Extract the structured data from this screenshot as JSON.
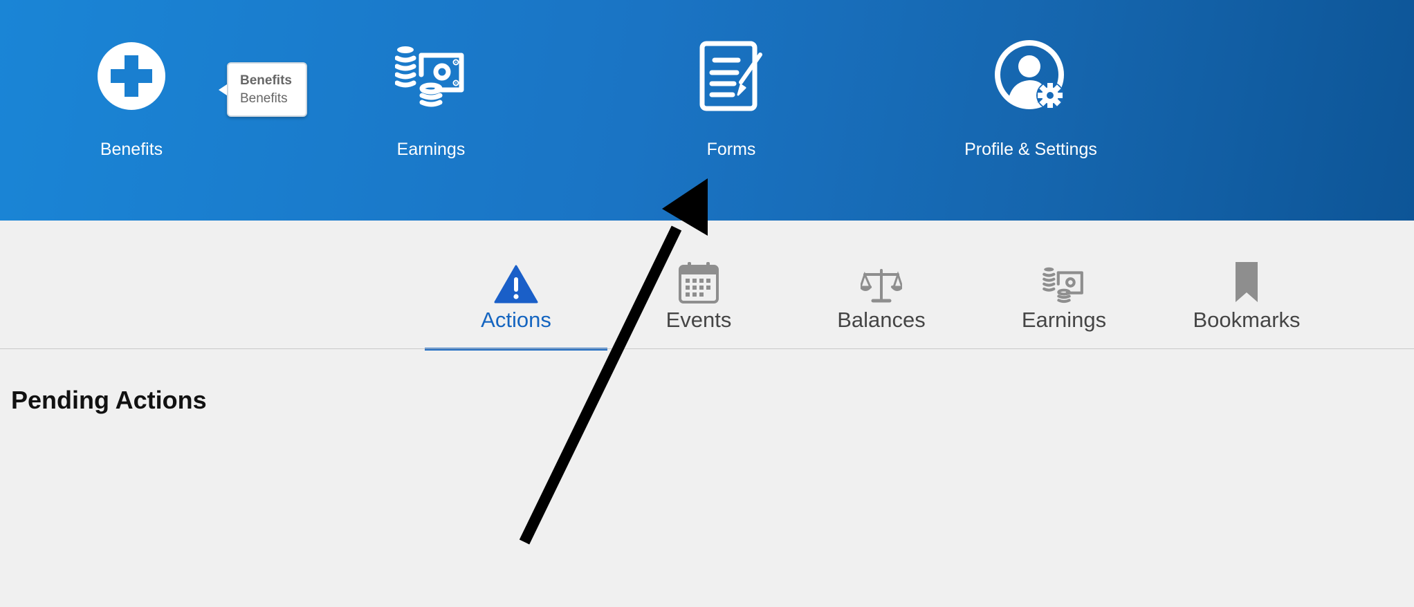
{
  "top_nav": {
    "items": [
      {
        "label": "Benefits",
        "icon": "plus-circle-icon"
      },
      {
        "label": "Earnings",
        "icon": "coins-money-icon"
      },
      {
        "label": "Forms",
        "icon": "form-document-icon"
      },
      {
        "label": "Profile & Settings",
        "icon": "user-gear-icon"
      }
    ],
    "tooltip": {
      "title": "Benefits",
      "text": "Benefits"
    }
  },
  "tabs": {
    "active": "Actions",
    "items": [
      {
        "label": "Actions",
        "icon": "warning-icon"
      },
      {
        "label": "Events",
        "icon": "calendar-icon"
      },
      {
        "label": "Balances",
        "icon": "scales-icon"
      },
      {
        "label": "Earnings",
        "icon": "coins-money-icon"
      },
      {
        "label": "Bookmarks",
        "icon": "bookmark-icon"
      }
    ]
  },
  "main": {
    "section_title": "Pending Actions"
  },
  "colors": {
    "banner": "#1a74c4",
    "active_tab": "#1565c0",
    "warning": "#1565c0",
    "inactive_icon": "#8e8e8e",
    "background": "#f0f0f0"
  }
}
